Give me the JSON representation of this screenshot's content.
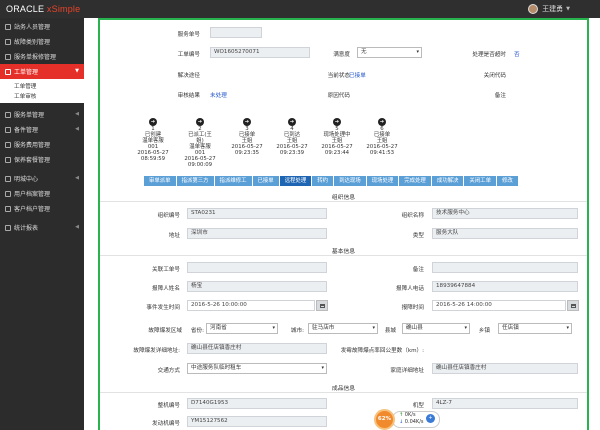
{
  "app": {
    "logo_brand": "ORACLE",
    "logo_product": " xSimple",
    "user_name": "王建勇"
  },
  "sidebar": {
    "items": [
      {
        "label": "站务人员管理"
      },
      {
        "label": "故障类别管理"
      },
      {
        "label": "服务单报修管理"
      },
      {
        "label": "工单管理"
      },
      {
        "label": "服务单管理"
      },
      {
        "label": "备件管理"
      },
      {
        "label": "服务费用管理"
      },
      {
        "label": "保养套餐管理"
      },
      {
        "label": "明城中心"
      },
      {
        "label": "用户档案管理"
      },
      {
        "label": "客户档户管理"
      },
      {
        "label": "统计报表"
      }
    ],
    "sub_items": [
      "工单管理",
      "工单审核"
    ]
  },
  "top": {
    "service_no_label": "服务单号",
    "order_no_label": "工单编号",
    "order_no_value": "WO1605270071",
    "satisfaction_label": "满意度",
    "satisfaction_value": "无",
    "timeout_label": "处理是否超时",
    "timeout_value": "否",
    "solution_label": "解决途径",
    "status_label": "当前状态",
    "status_value": "已接单",
    "close_code_label": "关闭代码",
    "review_label": "审核结果",
    "review_value": "未处理",
    "reason_label": "原因代码",
    "remark_label": "备注"
  },
  "steps": [
    {
      "num": "1",
      "lines": [
        "已创建",
        "温单客服",
        "001",
        "2016-05-27",
        "08:59:59"
      ]
    },
    {
      "num": "2",
      "lines": [
        "已派工(王",
        "姐)",
        "温单客服",
        "001",
        "2016-05-27",
        "09:00:09"
      ]
    },
    {
      "num": "3",
      "lines": [
        "已接单",
        "王姐",
        "2016-05-27",
        "09:23:35"
      ]
    },
    {
      "num": "4",
      "lines": [
        "已到达",
        "王姐",
        "2016-05-27",
        "09:23:39"
      ]
    },
    {
      "num": "5",
      "lines": [
        "现场处理中",
        "王姐",
        "2016-05-27",
        "09:23:44"
      ]
    },
    {
      "num": "6",
      "lines": [
        "已接单",
        "王姐",
        "2016-05-27",
        "09:41:53"
      ]
    }
  ],
  "tabs": [
    {
      "label": "审单派单",
      "active": false
    },
    {
      "label": "指派第三方",
      "active": false
    },
    {
      "label": "指派维修工",
      "active": false
    },
    {
      "label": "已接单",
      "active": false
    },
    {
      "label": "远程处理",
      "active": true
    },
    {
      "label": "转约",
      "active": false
    },
    {
      "label": "到达现场",
      "active": false
    },
    {
      "label": "现场处理",
      "active": false
    },
    {
      "label": "完成处理",
      "active": false
    },
    {
      "label": "成功解决",
      "active": false
    },
    {
      "label": "关闭工单",
      "active": false
    },
    {
      "label": "修改",
      "active": false
    }
  ],
  "org": {
    "section_title": "组织信息",
    "org_no_label": "组织编号",
    "org_no_value": "STA0231",
    "org_name_label": "组织名称",
    "org_name_value": "技术服务中心",
    "address_label": "地址",
    "address_value": "深圳市",
    "type_label": "类型",
    "type_value": "服务大队"
  },
  "basic": {
    "section_title": "基本信息",
    "related_order_label": "关联工单号",
    "remark_label": "备注",
    "reporter_label": "报障人姓名",
    "reporter_value": "杨宝",
    "phone_label": "报障人电话",
    "phone_value": "18939647884",
    "occur_time_label": "事件发生时间",
    "occur_time_value": "2016-5-26 10:00:00",
    "report_time_label": "报障时间",
    "report_time_value": "2016-5-26 14:00:00",
    "region_label": "故障爆发区域",
    "province_label": "省份:",
    "province_value": "河南省",
    "city_label": "城市:",
    "city_value": "驻马店市",
    "county_label": "县城",
    "county_value": "确山县",
    "town_label": "乡镇",
    "town_value": "任店镇",
    "detail_addr_label": "故障爆发详细地址:",
    "detail_addr_value": "确山县任店镇香庄村",
    "distance_label": "发霉故障爆点率回公里数（km）:",
    "transport_label": "交通方式",
    "transport_value": "中途服务队临时租车",
    "home_addr_label": "家庭详细地址",
    "home_addr_value": "确山县任店镇香庄村"
  },
  "product": {
    "section_title": "成品信息",
    "machine_no_label": "整机编号",
    "machine_no_value": "D7140G1953",
    "model_label": "机型",
    "model_value": "4LZ-7",
    "engine_no_label": "发动机编号",
    "engine_no_value": "YM15127562"
  },
  "net_widget": {
    "percent": "62%",
    "up": "0K/s",
    "down": "0.04K/s"
  }
}
